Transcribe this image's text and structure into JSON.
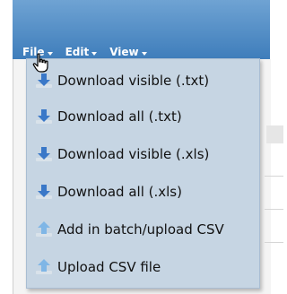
{
  "menubar": {
    "items": [
      {
        "label": "File"
      },
      {
        "label": "Edit"
      },
      {
        "label": "View"
      }
    ]
  },
  "file_menu": {
    "items": [
      {
        "label": "Download visible (.txt)",
        "icon": "download-icon"
      },
      {
        "label": "Download all (.txt)",
        "icon": "download-icon"
      },
      {
        "label": "Download visible (.xls)",
        "icon": "download-icon"
      },
      {
        "label": "Download all (.xls)",
        "icon": "download-icon"
      },
      {
        "label": "Add in batch/upload CSV",
        "icon": "upload-icon"
      },
      {
        "label": "Upload CSV file",
        "icon": "upload-icon"
      }
    ]
  },
  "colors": {
    "header_top": "#6fa3d3",
    "header_bottom": "#3e7dbb",
    "menu_bg": "#c6d5e3",
    "download_arrow": "#3a78c8",
    "upload_arrow": "#7fb6e6"
  }
}
